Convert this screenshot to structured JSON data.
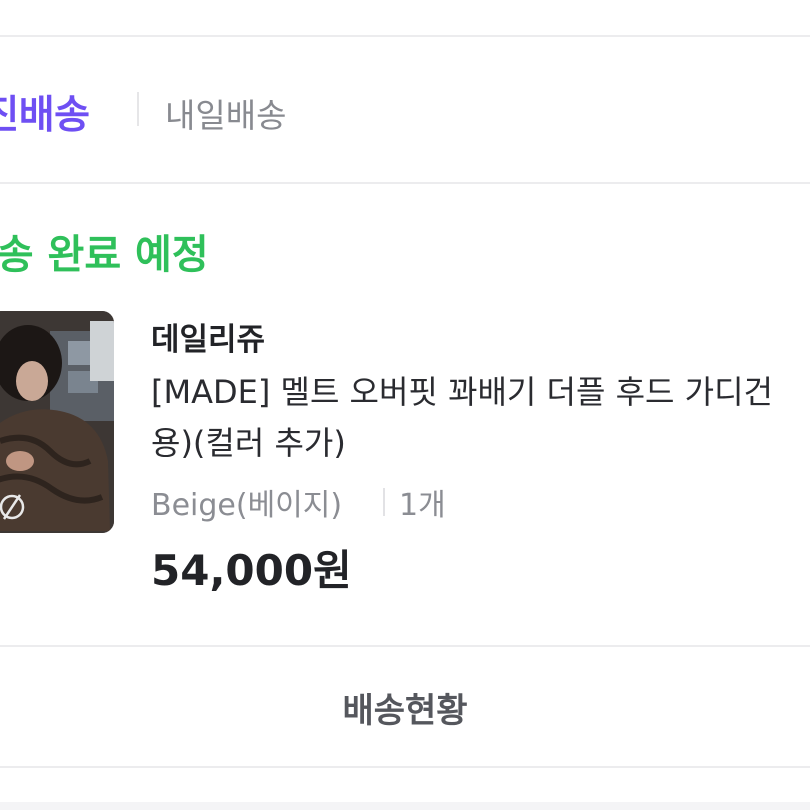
{
  "shipping_tabs": {
    "active_label": "직진배송",
    "other_label": "내일배송"
  },
  "order": {
    "status_label": "발송 완료 예정"
  },
  "product": {
    "store_name": "데일리쥬",
    "name_line1": "[MADE] 멜트 오버핏 꽈배기 더플 후드 가디건",
    "name_line2": "용)(컬러 추가)",
    "option": "Beige(베이지)",
    "quantity": "1개",
    "price": "54,000원"
  },
  "actions": {
    "track_label": "배송현황"
  },
  "colors": {
    "accent_purple": "#6e4ff3",
    "status_green": "#2fc05a",
    "text_dark": "#222327",
    "text_gray": "#8b8d93"
  }
}
